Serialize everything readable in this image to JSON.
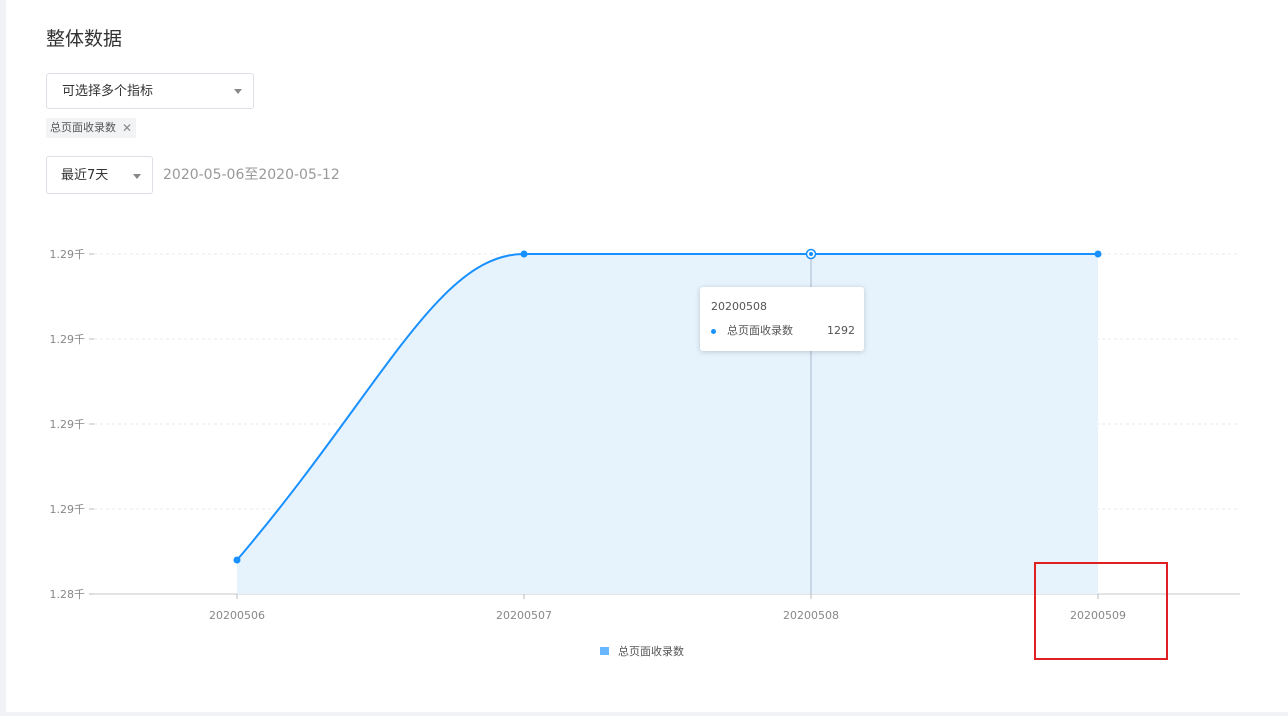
{
  "page": {
    "title": "整体数据"
  },
  "metric_select": {
    "placeholder": "可选择多个指标",
    "selected_tags": [
      "总页面收录数"
    ]
  },
  "range_select": {
    "value": "最近7天",
    "date_range": "2020-05-06至2020-05-12"
  },
  "tooltip": {
    "title": "20200508",
    "series_name": "总页面收录数",
    "value": "1292"
  },
  "legend": {
    "label": "总页面收录数"
  },
  "colors": {
    "line": "#1890ff",
    "area": "#e6f3fd",
    "highlight": "#e02020"
  },
  "chart_data": {
    "type": "area",
    "categories": [
      "20200506",
      "20200507",
      "20200508",
      "20200509"
    ],
    "y_tick_labels": [
      "1.28千",
      "1.29千",
      "1.29千",
      "1.29千",
      "1.29千"
    ],
    "series": [
      {
        "name": "总页面收录数",
        "values": [
          1283,
          1292,
          1292,
          1292
        ]
      }
    ],
    "ylim": [
      1282,
      1292
    ],
    "smooth": true,
    "grid": true,
    "legend_position": "bottom-center",
    "highlighted_category": "20200509"
  }
}
